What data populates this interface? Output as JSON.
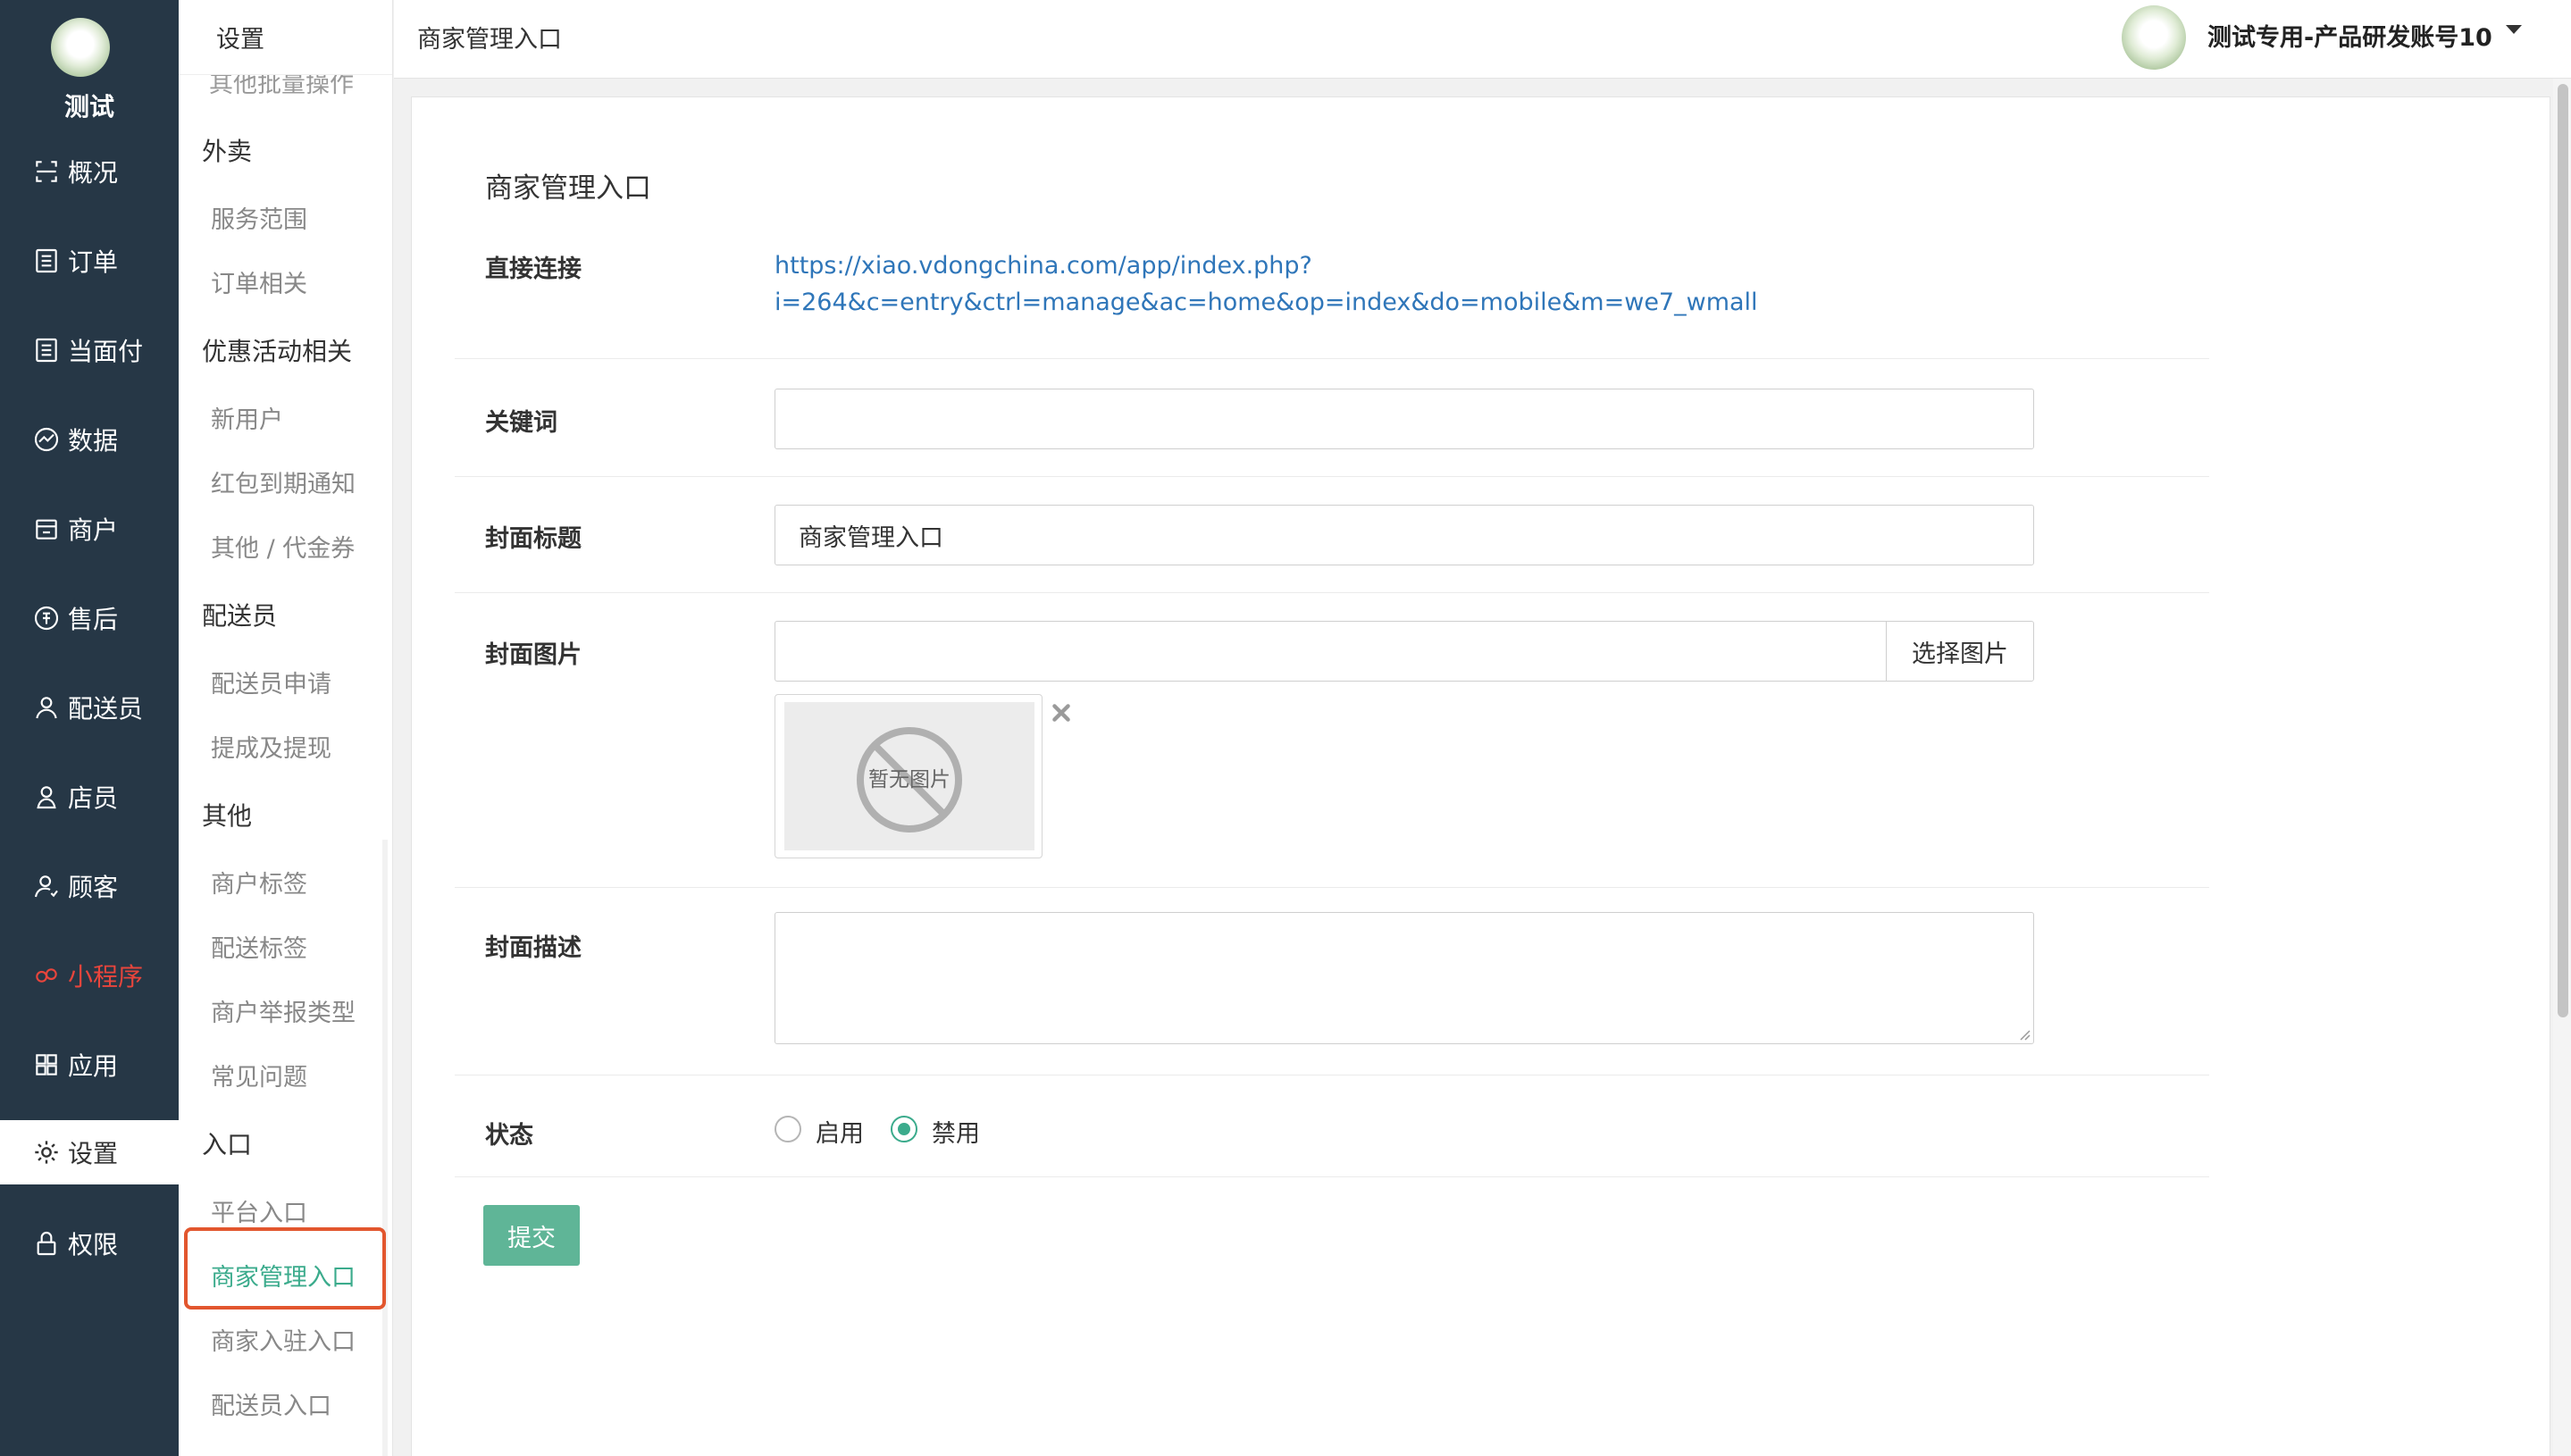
{
  "brand": {
    "name": "测试"
  },
  "main_nav": [
    {
      "label": "概况",
      "icon": "overview-icon"
    },
    {
      "label": "订单",
      "icon": "order-icon"
    },
    {
      "label": "当面付",
      "icon": "pay-icon"
    },
    {
      "label": "数据",
      "icon": "data-icon"
    },
    {
      "label": "商户",
      "icon": "store-icon"
    },
    {
      "label": "售后",
      "icon": "aftersale-icon"
    },
    {
      "label": "配送员",
      "icon": "courier-icon"
    },
    {
      "label": "店员",
      "icon": "clerk-icon"
    },
    {
      "label": "顾客",
      "icon": "customer-icon"
    },
    {
      "label": "小程序",
      "icon": "miniprogram-icon",
      "highlight": true
    },
    {
      "label": "应用",
      "icon": "apps-icon"
    },
    {
      "label": "设置",
      "icon": "settings-icon",
      "active": true
    },
    {
      "label": "权限",
      "icon": "lock-icon"
    }
  ],
  "sub_nav": {
    "title": "设置",
    "clipped_item": "其他批量操作",
    "groups": [
      {
        "title": "外卖",
        "items": [
          "服务范围",
          "订单相关"
        ]
      },
      {
        "title": "优惠活动相关",
        "items": [
          "新用户",
          "红包到期通知",
          "其他 / 代金券"
        ]
      },
      {
        "title": "配送员",
        "items": [
          "配送员申请",
          "提成及提现"
        ]
      },
      {
        "title": "其他",
        "items": [
          "商户标签",
          "配送标签",
          "商户举报类型",
          "常见问题"
        ]
      },
      {
        "title": "入口",
        "items": [
          "平台入口",
          "商家管理入口",
          "商家入驻入口",
          "配送员入口"
        ]
      }
    ],
    "active_item": "商家管理入口"
  },
  "header": {
    "breadcrumb": "商家管理入口",
    "user_name": "测试专用-产品研发账号10"
  },
  "form": {
    "title": "商家管理入口",
    "direct_link_label": "直接连接",
    "direct_link_line1": "https://xiao.vdongchina.com/app/index.php?",
    "direct_link_line2": "i=264&c=entry&ctrl=manage&ac=home&op=index&do=mobile&m=we7_wmall",
    "keyword_label": "关键词",
    "keyword_value": "",
    "cover_title_label": "封面标题",
    "cover_title_value": "商家管理入口",
    "cover_image_label": "封面图片",
    "cover_image_value": "",
    "choose_image_button": "选择图片",
    "no_image_text": "暂无图片",
    "cover_desc_label": "封面描述",
    "cover_desc_value": "",
    "status_label": "状态",
    "status_options": [
      "启用",
      "禁用"
    ],
    "status_selected": "禁用",
    "submit_button": "提交"
  },
  "colors": {
    "sidebar_bg": "#263746",
    "accent_green": "#3bab8c",
    "submit_green": "#5fb597",
    "link_blue": "#2f76b9",
    "highlight_red": "#e8453c",
    "annotation_orange": "#e2562e"
  }
}
